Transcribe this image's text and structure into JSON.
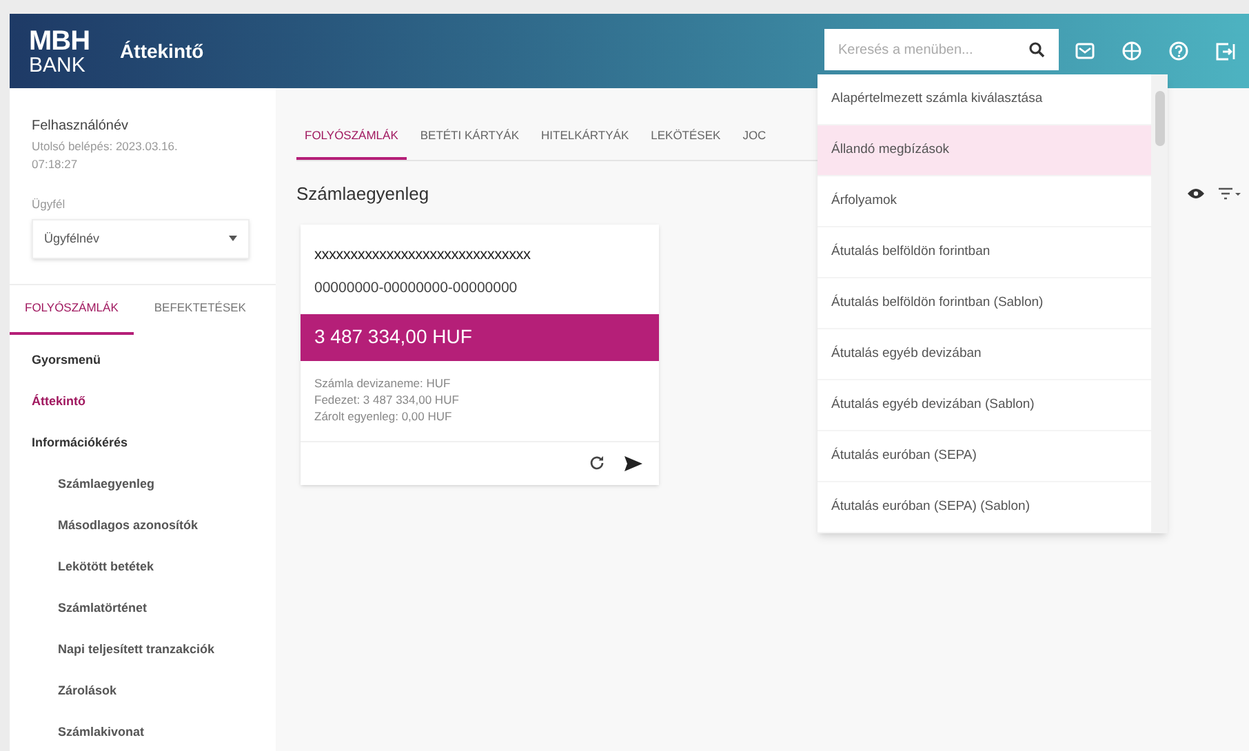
{
  "header": {
    "logo_top": "MBH",
    "logo_bottom": "BANK",
    "title": "Áttekintő",
    "search": {
      "placeholder": "Keresés a menüben..."
    }
  },
  "user": {
    "name": "Felhasználónév",
    "last_login": "Utolsó belépés: 2023.03.16. 07:18:27",
    "client_label": "Ügyfél",
    "client_value": "Ügyfélnév"
  },
  "sidebar_tabs": [
    {
      "label": "FOLYÓSZÁMLÁK",
      "selected": true
    },
    {
      "label": "BEFEKTETÉSEK",
      "selected": false
    }
  ],
  "sidebar_items": [
    {
      "label": "Gyorsmenü",
      "kind": "section",
      "selected": false
    },
    {
      "label": "Áttekintő",
      "kind": "section",
      "selected": true
    },
    {
      "label": "Információkérés",
      "kind": "section",
      "selected": false
    },
    {
      "label": "Számlaegyenleg",
      "kind": "sub",
      "selected": false
    },
    {
      "label": "Másodlagos azonosítók",
      "kind": "sub",
      "selected": false
    },
    {
      "label": "Lekötött betétek",
      "kind": "sub",
      "selected": false
    },
    {
      "label": "Számlatörténet",
      "kind": "sub",
      "selected": false
    },
    {
      "label": "Napi teljesített tranzakciók",
      "kind": "sub",
      "selected": false
    },
    {
      "label": "Zárolások",
      "kind": "sub",
      "selected": false
    },
    {
      "label": "Számlakivonat",
      "kind": "sub",
      "selected": false
    }
  ],
  "tabs": [
    {
      "label": "FOLYÓSZÁMLÁK",
      "selected": true
    },
    {
      "label": "BETÉTI KÁRTYÁK",
      "selected": false
    },
    {
      "label": "HITELKÁRTYÁK",
      "selected": false
    },
    {
      "label": "LEKÖTÉSEK",
      "selected": false
    },
    {
      "label": "JOC",
      "selected": false
    }
  ],
  "section_title": "Számlaegyenleg",
  "account_card": {
    "name": "xxxxxxxxxxxxxxxxxxxxxxxxxxxxxx",
    "number": "00000000-00000000-00000000",
    "balance": "3 487 334,00 HUF",
    "details": [
      "Számla devizaneme: HUF",
      "Fedezet: 3 487 334,00 HUF",
      "Zárolt egyenleg: 0,00 HUF"
    ]
  },
  "menu_dropdown": [
    {
      "label": "Alapértelmezett számla kiválasztása",
      "selected": false
    },
    {
      "label": "Állandó megbízások",
      "selected": true
    },
    {
      "label": "Árfolyamok",
      "selected": false
    },
    {
      "label": "Átutalás belföldön forintban",
      "selected": false
    },
    {
      "label": "Átutalás belföldön forintban (Sablon)",
      "selected": false
    },
    {
      "label": "Átutalás egyéb devizában",
      "selected": false
    },
    {
      "label": "Átutalás egyéb devizában (Sablon)",
      "selected": false
    },
    {
      "label": "Átutalás euróban (SEPA)",
      "selected": false
    },
    {
      "label": "Átutalás euróban (SEPA) (Sablon)",
      "selected": false
    }
  ]
}
